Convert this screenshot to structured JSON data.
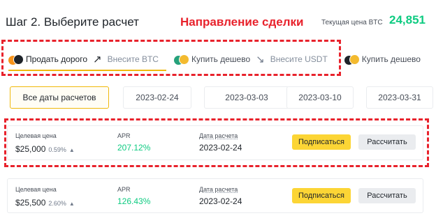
{
  "header": {
    "step_title": "Шаг 2. Выберите расчет",
    "annotation": "Направление сделки",
    "current_price_label": "Текущая цена BTC",
    "current_price_value": "24,851"
  },
  "direction_tabs": [
    {
      "label": "Продать дорого",
      "arrow": "↗",
      "hint": "Внесите BTC",
      "icon": "btc-coin-icon"
    },
    {
      "label": "Купить дешево",
      "arrow": "↘",
      "hint": "Внесите USDT",
      "icon": "usdt-coin-icon"
    },
    {
      "label": "Купить дешево",
      "icon": "bnb-coin-icon"
    }
  ],
  "date_filters": [
    {
      "label": "Все даты расчетов",
      "selected": true
    },
    {
      "label": "2023-02-24"
    },
    {
      "label": "2023-03-03"
    },
    {
      "label": "2023-03-10"
    },
    {
      "label": "2023-03-31"
    }
  ],
  "offers": [
    {
      "target_label": "Целевая цена",
      "target_value": "$25,000",
      "target_pct": "0.59%",
      "apr_label": "APR",
      "apr_value": "207.12%",
      "date_label": "Дата расчета",
      "date_value": "2023-02-24",
      "subscribe_label": "Подписаться",
      "calc_label": "Рассчитать"
    },
    {
      "target_label": "Целевая цена",
      "target_value": "$25,500",
      "target_pct": "2.60%",
      "apr_label": "APR",
      "apr_value": "126.43%",
      "date_label": "Дата расчета",
      "date_value": "2023-02-24",
      "subscribe_label": "Подписаться",
      "calc_label": "Рассчитать"
    }
  ],
  "colors": {
    "accent_yellow": "#f0b90b",
    "button_yellow": "#fcd535",
    "positive_green": "#0ecb81",
    "annotation_red": "#e8222c"
  }
}
